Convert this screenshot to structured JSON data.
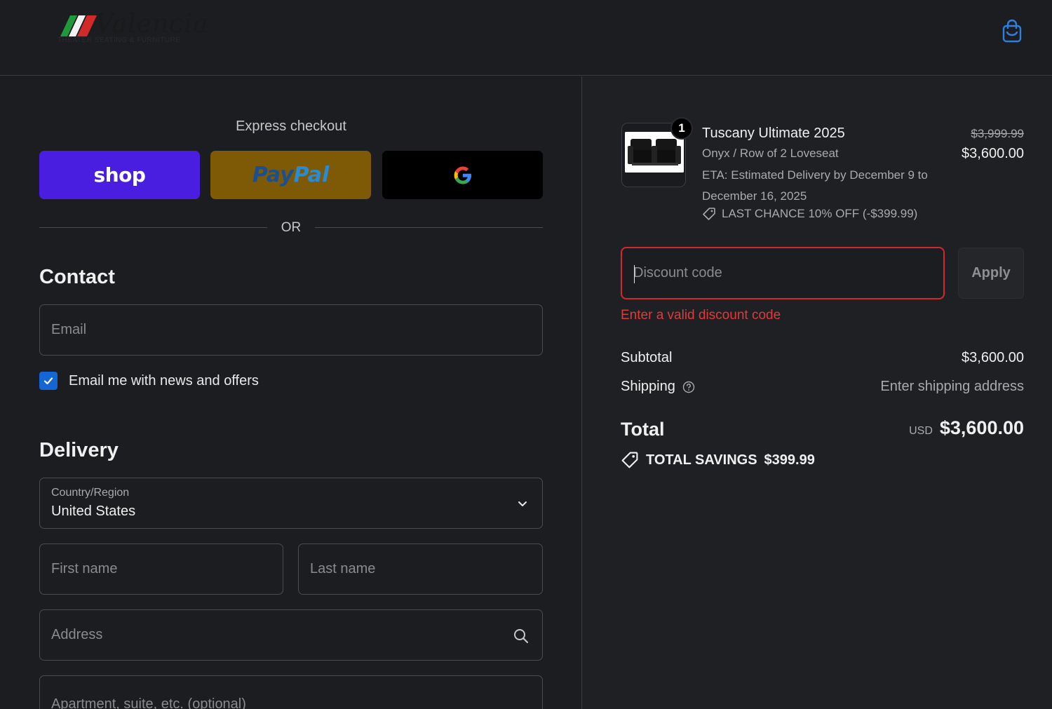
{
  "header": {
    "logo_word": "Valencia",
    "logo_sub": "THEATER SEATING & FURNITURE",
    "cart_icon": "shopping-bag-icon"
  },
  "express": {
    "title": "Express checkout",
    "shop_label": "shop",
    "paypal_label_1": "Pay",
    "paypal_label_2": "Pal",
    "google_icon": "google-g-icon",
    "or_label": "OR"
  },
  "contact": {
    "title": "Contact",
    "email_placeholder": "Email",
    "newsletter_label": "Email me with news and offers",
    "newsletter_checked": true
  },
  "delivery": {
    "title": "Delivery",
    "country_label": "Country/Region",
    "country_value": "United States",
    "first_name_placeholder": "First name",
    "last_name_placeholder": "Last name",
    "address_placeholder": "Address",
    "apartment_placeholder": "Apartment, suite, etc. (optional)"
  },
  "summary": {
    "product": {
      "quantity": "1",
      "name": "Tuscany Ultimate 2025",
      "variant": "Onyx / Row of 2 Loveseat",
      "eta": "ETA: Estimated Delivery by December 9 to December 16, 2025",
      "discount_note": "LAST CHANCE 10% OFF (-$399.99)",
      "price_original": "$3,999.99",
      "price_current": "$3,600.00"
    },
    "discount": {
      "placeholder": "Discount code",
      "apply_label": "Apply",
      "error": "Enter a valid discount code"
    },
    "subtotal_label": "Subtotal",
    "subtotal_value": "$3,600.00",
    "shipping_label": "Shipping",
    "shipping_value": "Enter shipping address",
    "total_label": "Total",
    "total_currency": "USD",
    "total_value": "$3,600.00",
    "savings_label": "TOTAL SAVINGS",
    "savings_value": "$399.99"
  },
  "colors": {
    "background": "#1c1d20",
    "summary_background": "#1f2023",
    "shop_pay": "#4a1ee0",
    "paypal": "#7e5a07",
    "checkbox": "#1466d4",
    "error": "#e03a3a",
    "cart_icon": "#2f7fe0"
  }
}
